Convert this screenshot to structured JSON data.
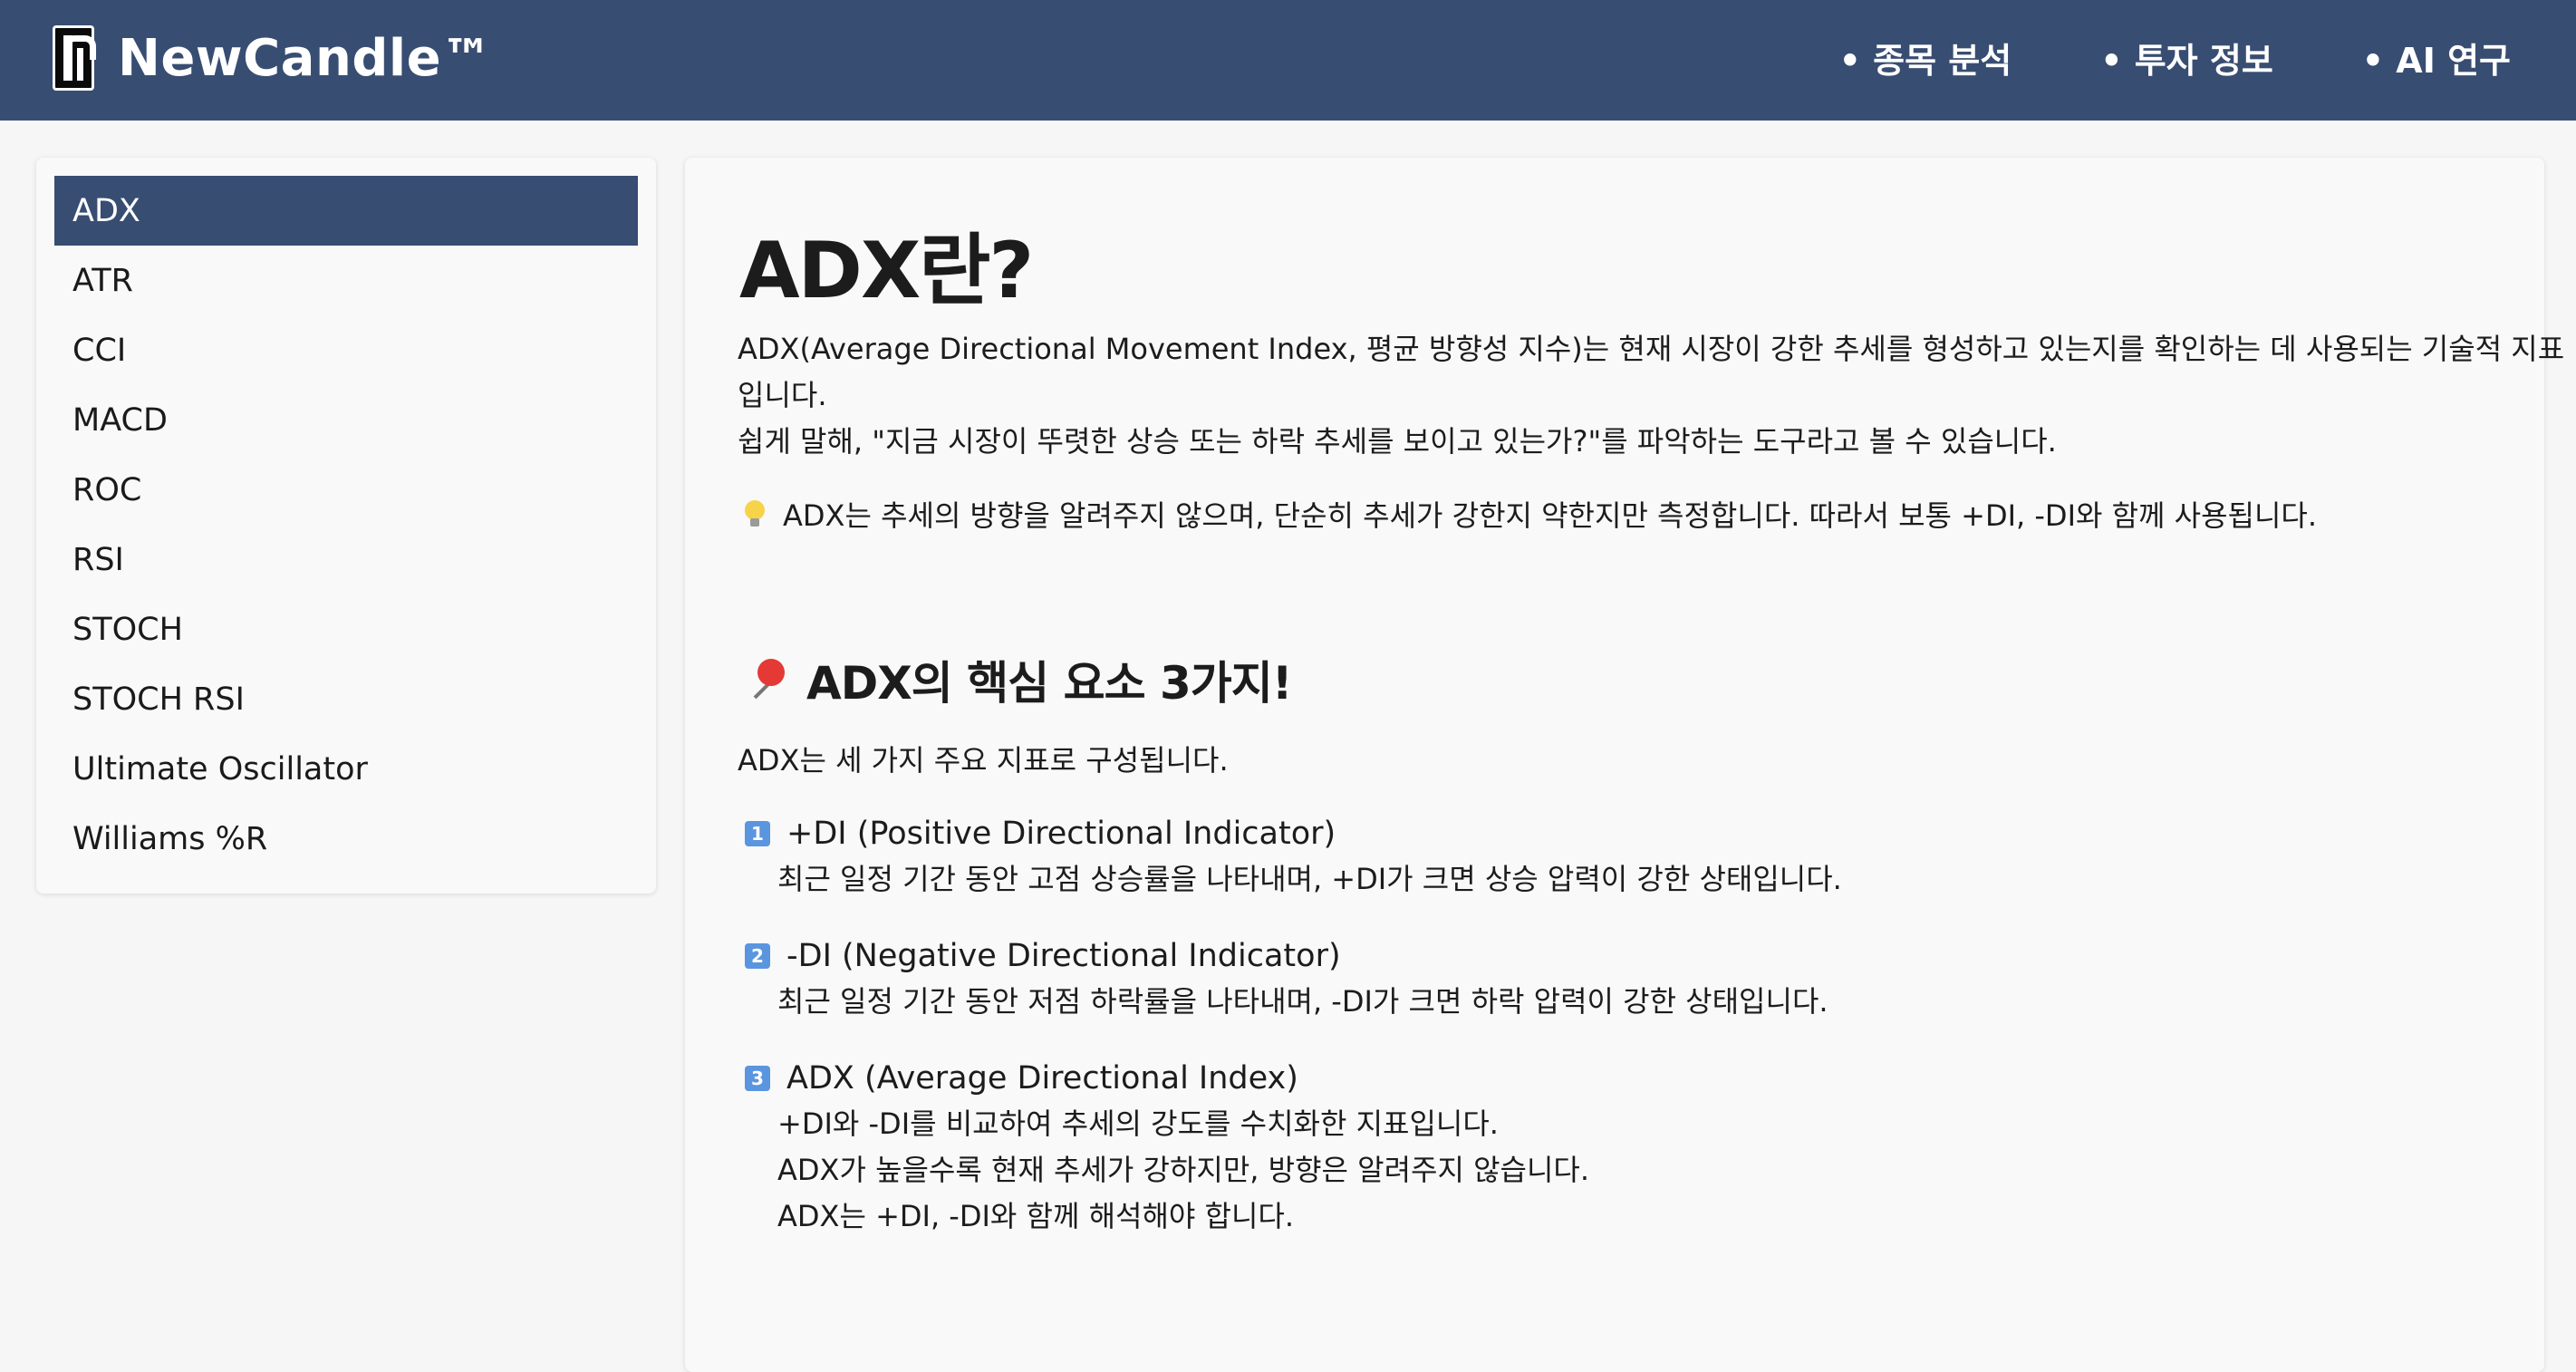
{
  "header": {
    "brand": "NewCandle™",
    "nav": [
      "• 종목 분석",
      "• 투자 정보",
      "• AI 연구"
    ]
  },
  "sidebar": {
    "items": [
      "ADX",
      "ATR",
      "CCI",
      "MACD",
      "ROC",
      "RSI",
      "STOCH",
      "STOCH RSI",
      "Ultimate Oscillator",
      "Williams %R"
    ],
    "active": "ADX"
  },
  "content": {
    "title": "ADX란?",
    "intro_lines": [
      "ADX(Average Directional Movement Index, 평균 방향성 지수)는 현재 시장이 강한 추세를 형성하고 있는지를 확인하는 데 사용되는 기술적 지표",
      "입니다.",
      "쉽게 말해, \"지금 시장이 뚜렷한 상승 또는 하락 추세를 보이고 있는가?\"를 파악하는 도구라고 볼 수 있습니다."
    ],
    "tip": "ADX는 추세의 방향을 알려주지 않으며, 단순히 추세가 강한지 약한지만 측정합니다. 따라서 보통 +DI, -DI와 함께 사용됩니다.",
    "section_title": "ADX의 핵심 요소 3가지!",
    "section_intro": "ADX는 세 가지 주요 지표로 구성됩니다.",
    "items": [
      {
        "num": "1",
        "title": "+DI (Positive Directional Indicator)",
        "desc": [
          "최근 일정 기간 동안 고점 상승률을 나타내며, +DI가 크면 상승 압력이 강한 상태입니다."
        ]
      },
      {
        "num": "2",
        "title": "-DI (Negative Directional Indicator)",
        "desc": [
          "최근 일정 기간 동안 저점 하락률을 나타내며, -DI가 크면 하락 압력이 강한 상태입니다."
        ]
      },
      {
        "num": "3",
        "title": "ADX (Average Directional Index)",
        "desc": [
          "+DI와 -DI를 비교하여 추세의 강도를 수치화한 지표입니다.",
          "ADX가 높을수록 현재 추세가 강하지만, 방향은 알려주지 않습니다.",
          "ADX는 +DI, -DI와 함께 해석해야 합니다."
        ]
      }
    ]
  },
  "colors": {
    "header_bg": "#384d72",
    "active_item_bg": "#384d72",
    "badge_bg": "#5a95e0"
  }
}
